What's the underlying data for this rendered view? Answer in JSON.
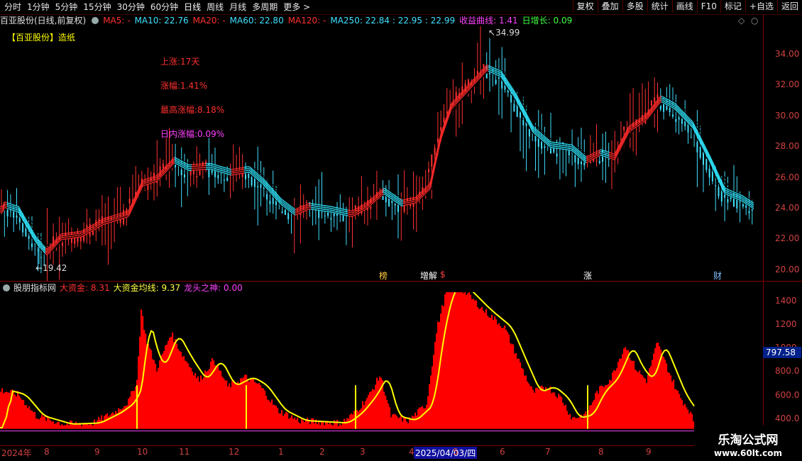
{
  "toolbar": {
    "periods": [
      "分时",
      "1分钟",
      "5分钟",
      "15分钟",
      "30分钟",
      "60分钟",
      "日线",
      "周线",
      "月线",
      "多周期",
      "更多 >"
    ],
    "active_index": 6,
    "right": [
      "复权",
      "叠加",
      "多股",
      "统计",
      "画线",
      "F10",
      "标记",
      "+自选",
      "返回"
    ]
  },
  "main": {
    "stock_title": "百亚股份(日线,前复权)",
    "ma": [
      {
        "label": "MA5: -",
        "color": "#ff3030"
      },
      {
        "label": "MA10: 22.76",
        "color": "#40e0ff"
      },
      {
        "label": "MA20: -",
        "color": "#ff3030"
      },
      {
        "label": "MA60: 22.80",
        "color": "#40e0ff"
      },
      {
        "label": "MA120: -",
        "color": "#ff3030"
      },
      {
        "label": "MA250: 22.84 : 22.95 : 22.99",
        "color": "#40e0ff"
      },
      {
        "label": "收益曲线: 1.41",
        "color": "#ff40ff"
      },
      {
        "label": "日增长: 0.09",
        "color": "#40ff40"
      }
    ],
    "tag_name": "【百亚股份】",
    "tag_industry": "造纸",
    "stats": {
      "up_days": "上涨:17天",
      "change": "涨幅:1.41%",
      "max_change": "最高涨幅:8.18%",
      "intraday": "日内涨幅:0.09%"
    },
    "high_label": "34.99",
    "low_label": "19.42",
    "y_ticks": [
      "34.00",
      "32.00",
      "30.00",
      "28.00",
      "26.00",
      "24.00",
      "22.00",
      "20.00"
    ],
    "marks": [
      {
        "text": "榜",
        "color": "#ffcc40"
      },
      {
        "text": "增解",
        "color": "#ffffff"
      },
      {
        "text": "$",
        "color": "#ff4040"
      },
      {
        "text": "涨",
        "color": "#ffffff"
      },
      {
        "text": "财",
        "color": "#80c0ff"
      }
    ]
  },
  "sub": {
    "title": "股朋指标网",
    "items": [
      {
        "label": "大资金: 8.31",
        "color": "#ff3030"
      },
      {
        "label": "大资金均线: 9.37",
        "color": "#ffff40"
      },
      {
        "label": "龙头之神: 0.00",
        "color": "#ff40ff"
      }
    ],
    "y_ticks": [
      "1400",
      "1200",
      "1000",
      "800.0",
      "600.0",
      "400.0",
      "200.0"
    ],
    "current_value": "797.58"
  },
  "xaxis": {
    "labels": [
      "2024年",
      "8",
      "9",
      "10",
      "11",
      "12",
      "1",
      "2",
      "3",
      "4",
      "5",
      "6",
      "7",
      "8",
      "9"
    ],
    "selected_date": "2025/04/03/四"
  },
  "watermark": {
    "line1": "乐淘公式网",
    "line2": "www.60lt.com"
  },
  "chart_data": {
    "type": "line",
    "title": "百亚股份(日线,前复权)",
    "x": [
      "2024-07",
      "2024-08",
      "2024-09",
      "2024-10",
      "2024-11",
      "2024-12",
      "2025-01",
      "2025-02",
      "2025-03",
      "2025-04",
      "2025-05",
      "2025-06",
      "2025-07",
      "2025-08",
      "2025-09"
    ],
    "series": [
      {
        "name": "MA10",
        "values": [
          23.0,
          21.0,
          21.5,
          24.5,
          25.5,
          25.0,
          23.5,
          22.8,
          23.5,
          24.0,
          31.5,
          28.0,
          26.5,
          29.5,
          22.8
        ]
      },
      {
        "name": "大资金均线",
        "values": [
          500,
          250,
          300,
          950,
          700,
          600,
          250,
          200,
          350,
          1380,
          1050,
          480,
          320,
          900,
          200
        ]
      }
    ],
    "ylim_main": [
      19.4,
      35.0
    ],
    "ylim_sub": [
      200,
      1450
    ]
  }
}
